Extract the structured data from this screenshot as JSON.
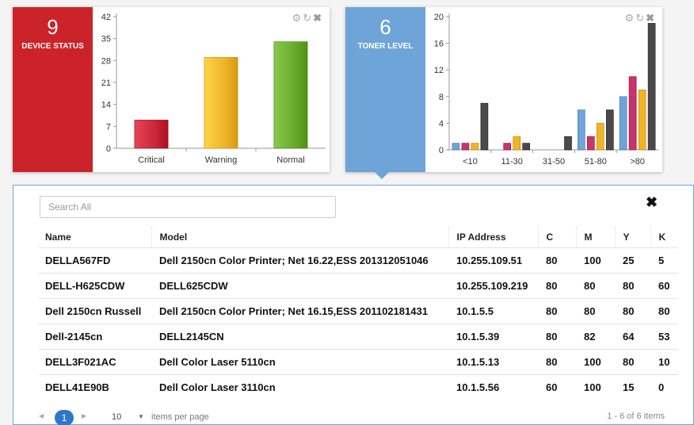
{
  "device_widget": {
    "count": "9",
    "label": "DEVICE STATUS",
    "tile_color": "#cc2229"
  },
  "toner_widget": {
    "count": "6",
    "label": "TONER LEVEL",
    "tile_color": "#6fa4d8"
  },
  "widget_tools": [
    "gear-icon",
    "refresh-icon",
    "close-icon"
  ],
  "chart_data": [
    {
      "type": "bar",
      "categories": [
        "Critical",
        "Warning",
        "Normal"
      ],
      "values": [
        9,
        29,
        34
      ],
      "colors": [
        "#c8283a",
        "#f0b429",
        "#6aab2e"
      ],
      "yticks": [
        0,
        7,
        14,
        21,
        28,
        35,
        42
      ],
      "ylim": [
        0,
        42
      ]
    },
    {
      "type": "bar",
      "categories": [
        "<10",
        "11-30",
        "31-50",
        "51-80",
        ">80"
      ],
      "series": [
        {
          "values": [
            1,
            0,
            0,
            6,
            8
          ],
          "color": "#6fa4d8"
        },
        {
          "values": [
            1,
            1,
            0,
            2,
            11
          ],
          "color": "#c8356a"
        },
        {
          "values": [
            1,
            2,
            0,
            4,
            9
          ],
          "color": "#f0b429"
        },
        {
          "values": [
            7,
            1,
            2,
            6,
            19
          ],
          "color": "#4a4a4a"
        }
      ],
      "yticks": [
        0,
        4,
        8,
        12,
        16,
        20
      ],
      "ylim": [
        0,
        20
      ]
    }
  ],
  "grid": {
    "search_placeholder": "Search All",
    "columns": {
      "name": "Name",
      "model": "Model",
      "ip": "IP Address",
      "c": "C",
      "m": "M",
      "y": "Y",
      "k": "K"
    },
    "rows": [
      {
        "name": "DELLA567FD",
        "model": "Dell 2150cn Color Printer; Net 16.22,ESS 201312051046",
        "ip": "10.255.109.51",
        "c": "80",
        "m": "100",
        "y": "25",
        "k": "5"
      },
      {
        "name": "DELL-H625CDW",
        "model": "DELL625CDW",
        "ip": "10.255.109.219",
        "c": "80",
        "m": "80",
        "y": "80",
        "k": "60"
      },
      {
        "name": "Dell 2150cn Russell",
        "model": "Dell 2150cn Color Printer; Net 16.15,ESS 201102181431",
        "ip": "10.1.5.5",
        "c": "80",
        "m": "80",
        "y": "80",
        "k": "80"
      },
      {
        "name": "Dell-2145cn",
        "model": "DELL2145CN",
        "ip": "10.1.5.39",
        "c": "80",
        "m": "82",
        "y": "64",
        "k": "53"
      },
      {
        "name": "DELL3F021AC",
        "model": "Dell Color Laser 5110cn",
        "ip": "10.1.5.13",
        "c": "80",
        "m": "100",
        "y": "80",
        "k": "10"
      },
      {
        "name": "DELL41E90B",
        "model": "Dell Color Laser 3110cn",
        "ip": "10.1.5.56",
        "c": "60",
        "m": "100",
        "y": "15",
        "k": "0"
      }
    ],
    "pager": {
      "current_page": "1",
      "page_size": "10",
      "items_per_page_label": "items per page",
      "count_label": "1 - 6 of 6 items"
    }
  }
}
